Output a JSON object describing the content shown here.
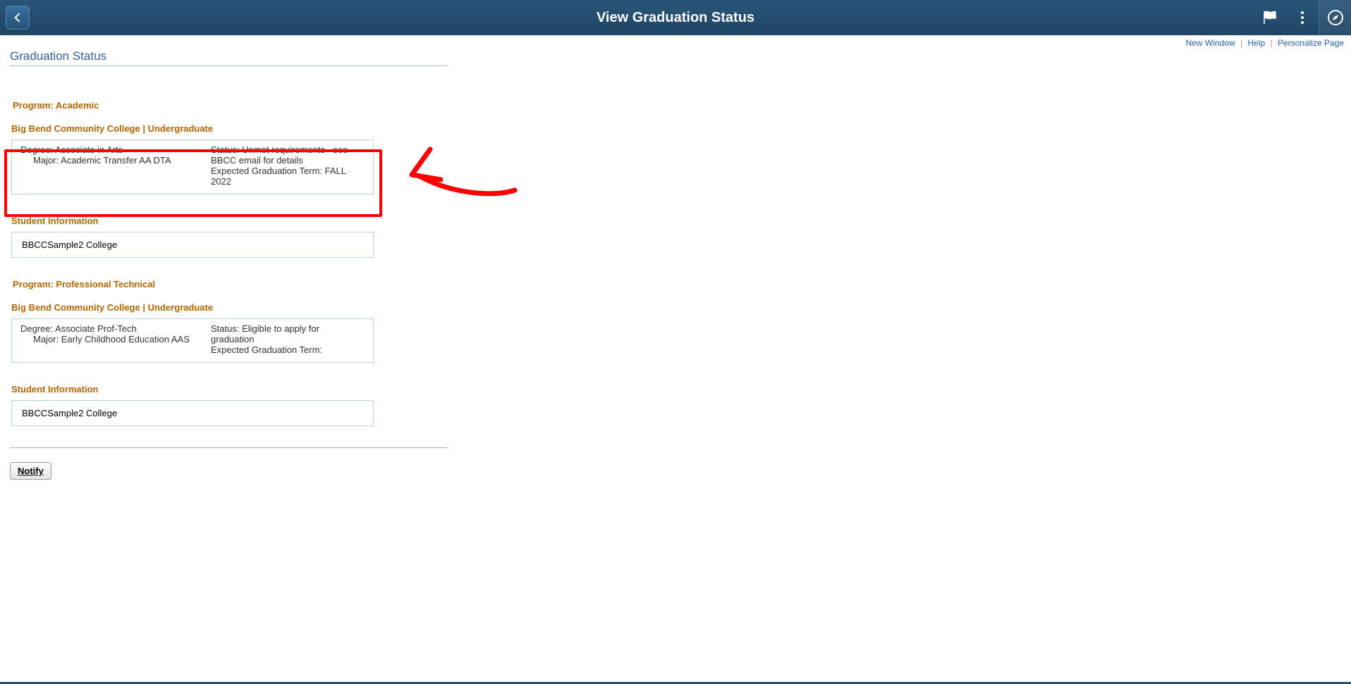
{
  "header": {
    "title": "View Graduation Status"
  },
  "subnav": {
    "new_window": "New Window",
    "help": "Help",
    "personalize": "Personalize Page"
  },
  "page": {
    "title": "Graduation Status"
  },
  "programs": [
    {
      "program_label": "Program: Academic",
      "institution_label": "Big Bend Community College | Undergraduate",
      "degree_label": "Degree:",
      "degree_value": "Associate in Arts",
      "major_label": "Major:",
      "major_value": "Academic Transfer AA DTA",
      "status_label": "Status:",
      "status_value": "Unmet requirements - see BBCC email for details",
      "term_label": "Expected Graduation Term:",
      "term_value": "FALL 2022",
      "student_info_label": "Student Information",
      "student_name": "BBCCSample2 College"
    },
    {
      "program_label": "Program: Professional Technical",
      "institution_label": "Big Bend Community College | Undergraduate",
      "degree_label": "Degree:",
      "degree_value": "Associate Prof-Tech",
      "major_label": "Major:",
      "major_value": "Early Childhood Education AAS",
      "status_label": "Status:",
      "status_value": "Eligible to apply for graduation",
      "term_label": "Expected Graduation Term:",
      "term_value": "",
      "student_info_label": "Student Information",
      "student_name": "BBCCSample2 College"
    }
  ],
  "buttons": {
    "notify": "Notify"
  }
}
